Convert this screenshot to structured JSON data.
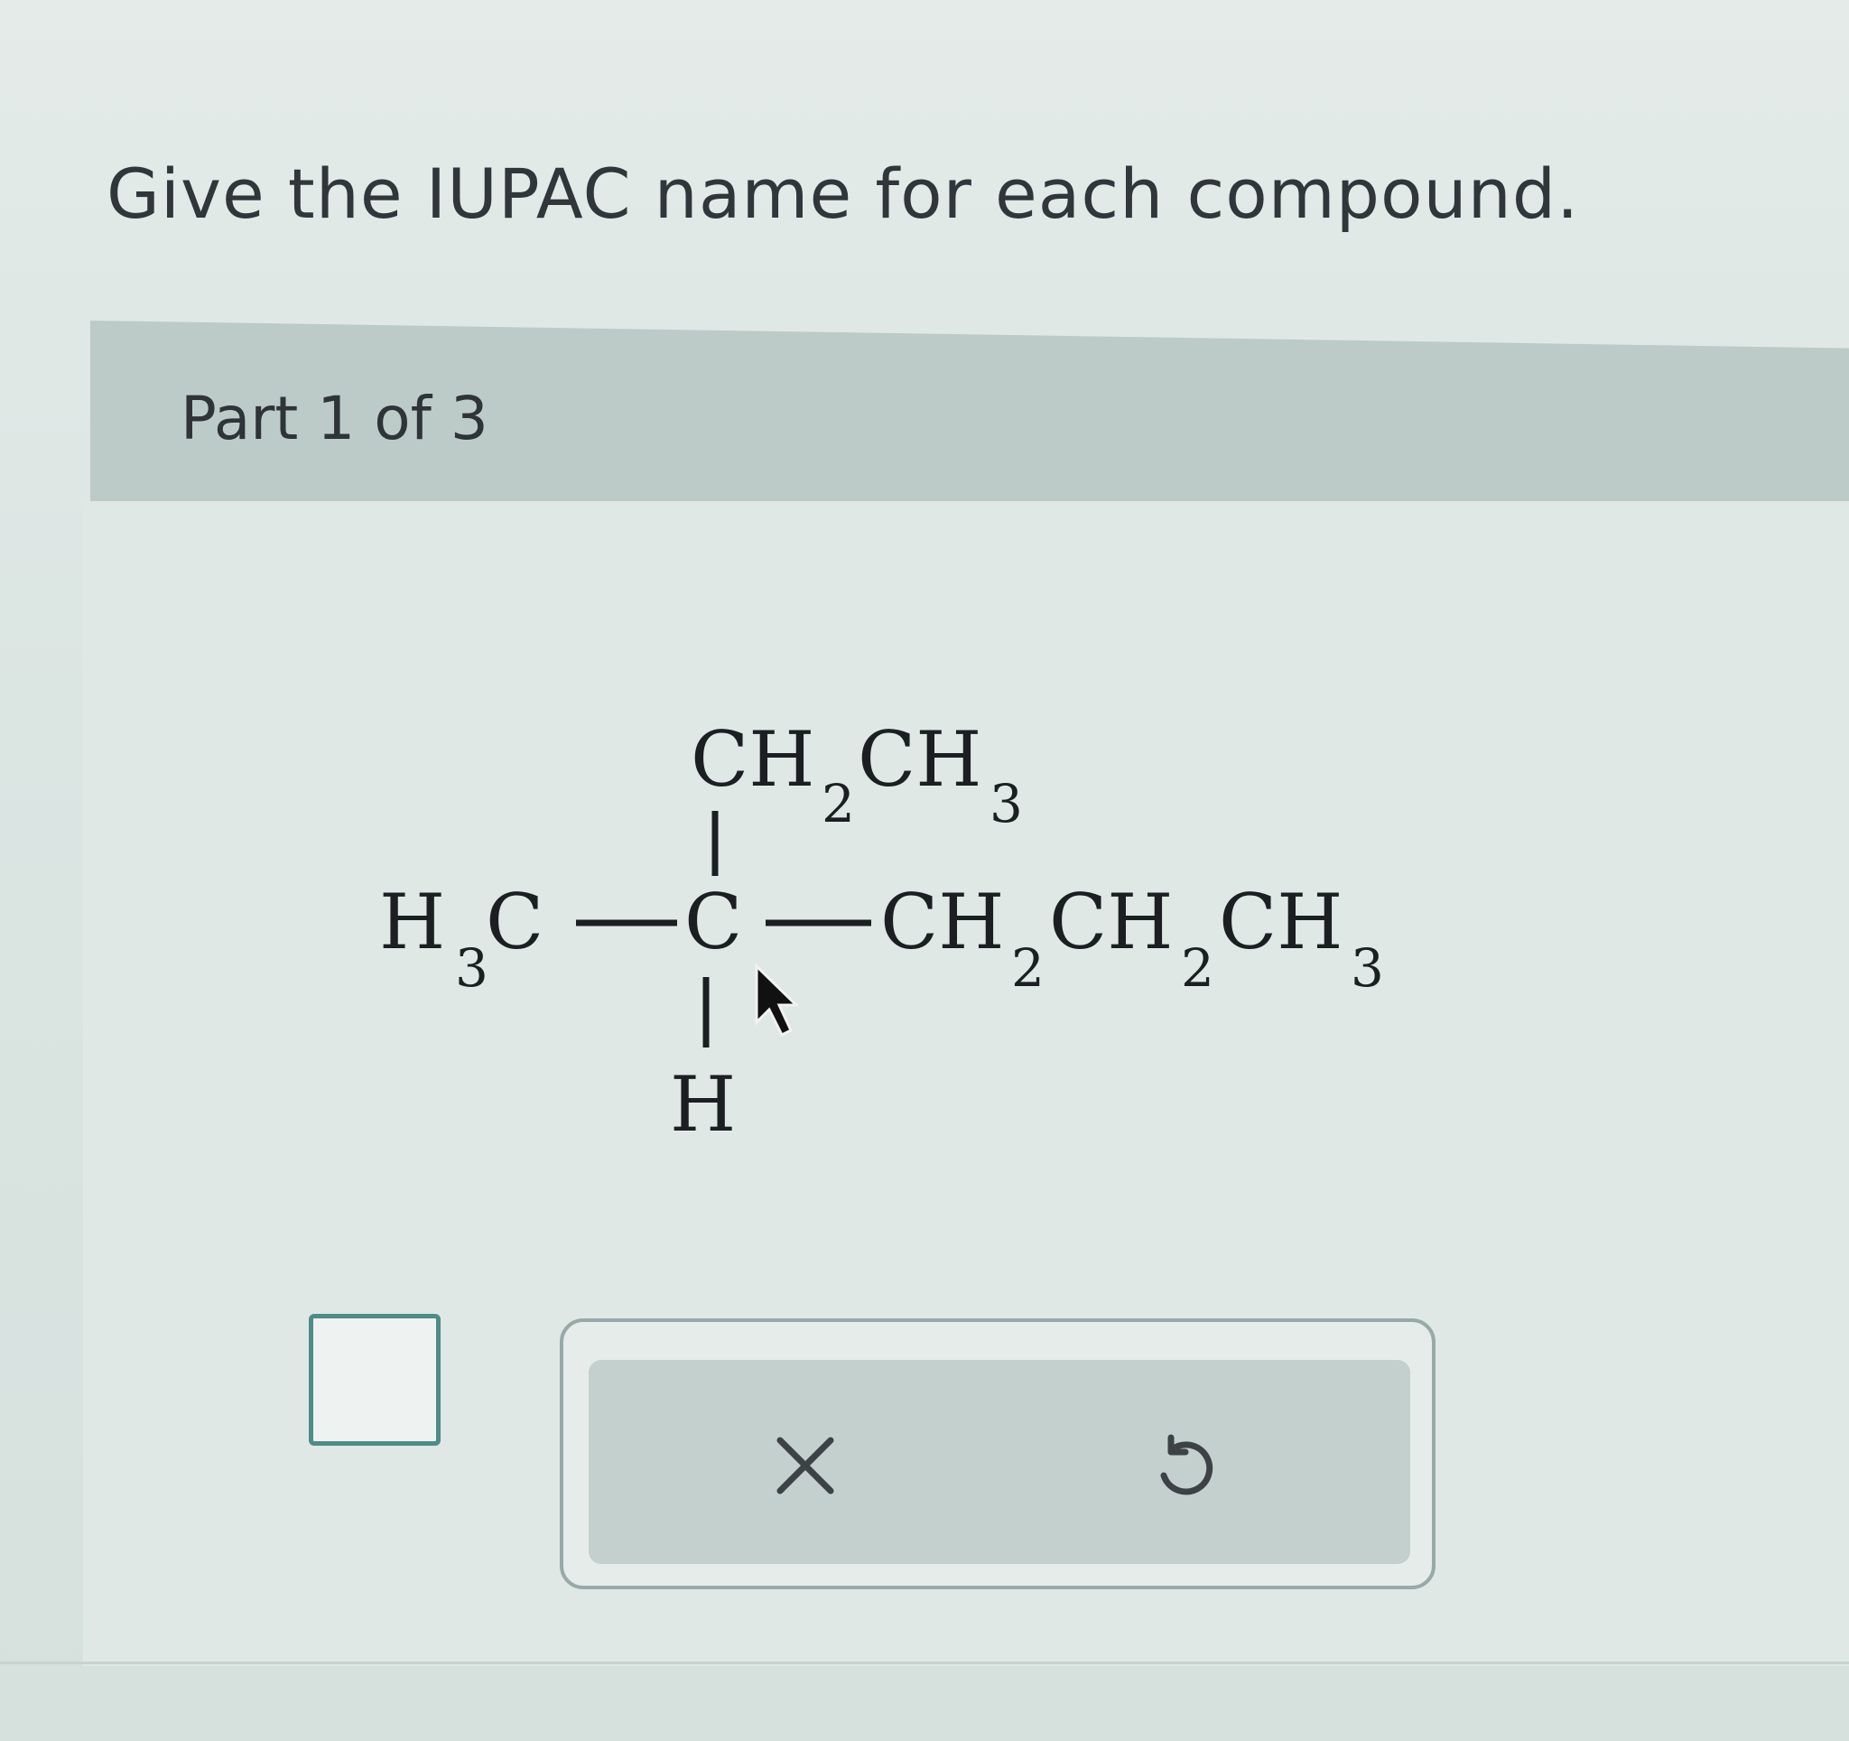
{
  "question": {
    "prompt": "Give the IUPAC name for each compound."
  },
  "part": {
    "label": "Part 1 of 3"
  },
  "molecule": {
    "top_group": {
      "a": "CH",
      "a_sub": "2",
      "b": "CH",
      "b_sub": "3"
    },
    "left_group": {
      "a": "H",
      "a_sub": "3",
      "b": "C"
    },
    "center_atom": "C",
    "right_group": {
      "a": "CH",
      "a_sub": "2",
      "b": "CH",
      "b_sub": "2",
      "c": "CH",
      "c_sub": "3"
    },
    "bottom_atom": "H"
  },
  "toolbar": {
    "clear_icon": "close-icon",
    "undo_icon": "undo-icon"
  },
  "colors": {
    "accent": "#4f8b87",
    "header_bg": "#bccbc8",
    "panel_bg": "#c3d0cd"
  }
}
